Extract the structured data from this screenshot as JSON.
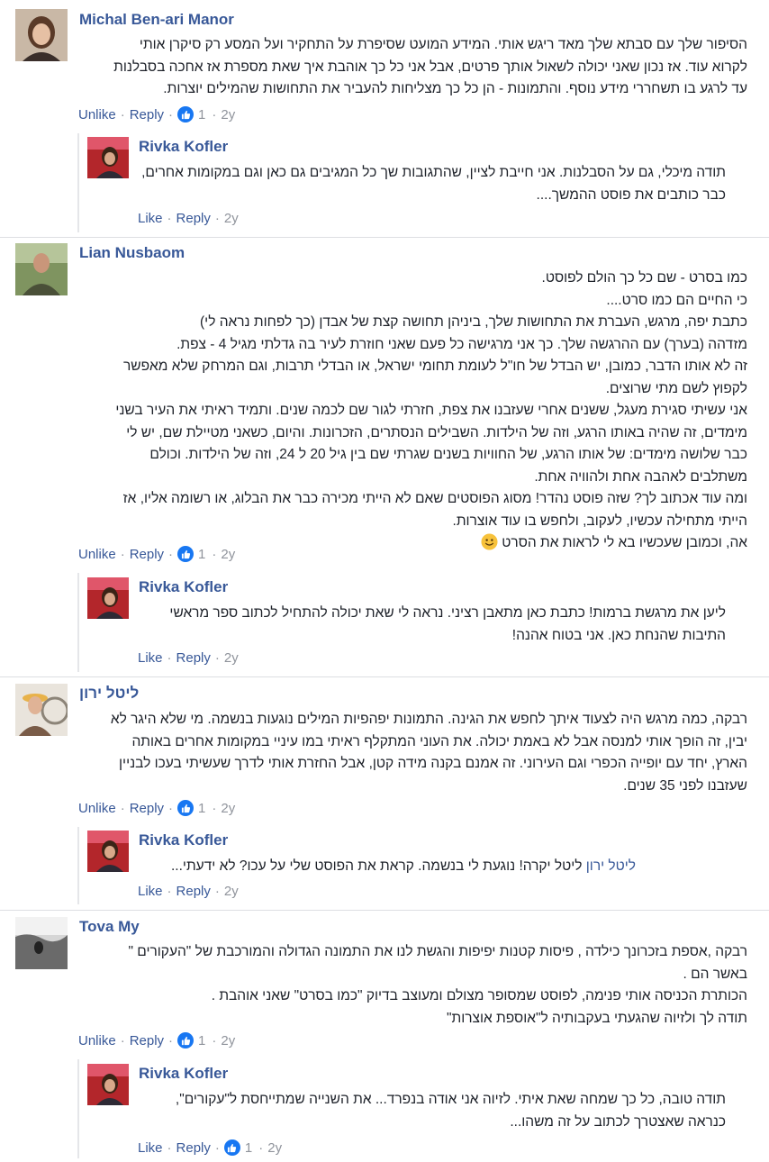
{
  "comments": [
    {
      "author": "Michal Ben-ari Manor",
      "lines": [
        "הסיפור שלך עם סבתא שלך מאד ריגש אותי. המידע המועט שסיפרת על התחקיר ועל המסע רק סיקרן אותי",
        "לקרוא עוד. אז נכון שאני יכולה לשאול אותך פרטים, אבל אני כל כך אוהבת איך שאת מספרת אז אחכה בסבלנות",
        "עד לרגע בו תשחררי מידע נוסף. והתמונות - הן כל כך מצליחות להעביר את התחושות שהמילים יוצרות."
      ],
      "actions": {
        "like": "Unlike",
        "reply": "Reply",
        "count": "1",
        "time": "2y"
      },
      "reply": {
        "author": "Rivka Kofler",
        "lines": [
          "תודה מיכלי, גם על הסבלנות. אני חייבת לציין, שהתגובות שך כל המגיבים גם כאן וגם במקומות אחרים,",
          "כבר כותבים את פוסט ההמשך...."
        ],
        "actions": {
          "like": "Like",
          "reply": "Reply",
          "time": "2y"
        }
      }
    },
    {
      "author": "Lian Nusbaom",
      "lines": [
        "כמו בסרט - שם כל כך הולם לפוסט.",
        "כי החיים הם כמו סרט....",
        "כתבת יפה, מרגש, העברת את התחושות שלך, ביניהן תחושה קצת של אבדן (כך לפחות נראה לי)",
        "מזדהה (בערך) עם ההרגשה שלך. כך אני מרגישה כל פעם שאני חוזרת לעיר בה גדלתי מגיל 4 - צפת.",
        "זה לא אותו הדבר, כמובן, יש הבדל של חו\"ל לעומת תחומי ישראל, או הבדלי תרבות, וגם המרחק שלא מאפשר",
        "לקפוץ לשם מתי שרוצים.",
        "אני עשיתי סגירת מעגל, ששנים אחרי שעזבנו את צפת, חזרתי לגור שם לכמה שנים. ותמיד ראיתי את העיר בשני",
        "מימדים, זה שהיה באותו הרגע, וזה של הילדות. השבילים הנסתרים, הזכרונות. והיום, כשאני מטיילת שם, יש לי",
        "כבר שלושה מימדים: של אותו הרגע, של החוויות בשנים שגרתי שם בין גיל 20 ל 24, וזה של הילדות. וכולם",
        "משתלבים לאהבה אחת ולהוויה אחת.",
        "ומה עוד אכתוב לך? שזה פוסט נהדר! מסוג הפוסטים שאם לא הייתי מכירה כבר את הבלוג, או רשומה אליו, אז",
        "הייתי מתחילה עכשיו, לעקוב, ולחפש בו עוד אוצרות.",
        "אה, וכמובן שעכשיו בא לי לראות את הסרט"
      ],
      "emoji_name": "smiley-emoji",
      "actions": {
        "like": "Unlike",
        "reply": "Reply",
        "count": "1",
        "time": "2y"
      },
      "reply": {
        "author": "Rivka Kofler",
        "lines": [
          "ליען את מרגשת ברמות! כתבת כאן מתאבן רציני. נראה לי שאת יכולה להתחיל לכתוב ספר מראשי",
          "התיבות שהנחת כאן. אני בטוח אהנה!"
        ],
        "actions": {
          "like": "Like",
          "reply": "Reply",
          "time": "2y"
        }
      }
    },
    {
      "author": "ליטל ירון",
      "lines": [
        "רבקה, כמה מרגש היה לצעוד איתך לחפש את הגינה. התמונות יפהפיות המילים נוגעות בנשמה. מי שלא היגר לא",
        "יבין, זה הופך אותי למנסה אבל לא באמת יכולה. את העוני המתקלף ראיתי במו עיניי במקומות אחרים באותה",
        "הארץ, יחד עם יופייה הכפרי וגם העירוני. זה אמנם בקנה מידה קטן, אבל החזרת אותי לדרך שעשיתי בעכו לבניין",
        "שעזבנו לפני 35 שנים."
      ],
      "actions": {
        "like": "Unlike",
        "reply": "Reply",
        "count": "1",
        "time": "2y"
      },
      "reply": {
        "author": "Rivka Kofler",
        "tag": "ליטל ירון",
        "lines": [
          "ליטל יקרה! נוגעת לי בנשמה. קראת את הפוסט שלי על עכו? לא ידעתי..."
        ],
        "actions": {
          "like": "Like",
          "reply": "Reply",
          "time": "2y"
        }
      }
    },
    {
      "author": "Tova My",
      "lines": [
        "רבקה ,אספת בזכרונך כילדה , פיסות קטנות יפיפות והגשת לנו את התמונה הגדולה והמורכבת של \"העקורים \"",
        "באשר הם .",
        "הכותרת הכניסה אותי פנימה, לפוסט שמסופר מצולם ומעוצב בדיוק \"כמו בסרט\" שאני אוהבת .",
        "תודה לך ולזיוה שהגעתי בעקבותיה ל\"אוספת אוצרות\""
      ],
      "actions": {
        "like": "Unlike",
        "reply": "Reply",
        "count": "1",
        "time": "2y"
      },
      "reply": {
        "author": "Rivka Kofler",
        "lines": [
          "תודה טובה, כל כך שמחה שאת איתי. לזיוה אני אודה בנפרד... את השנייה שמתייחסת ל\"עקורים\",",
          "כנראה שאצטרך לכתוב על זה משהו..."
        ],
        "actions": {
          "like": "Like",
          "reply": "Reply",
          "count": "1",
          "time": "2y"
        }
      }
    }
  ],
  "colors": {
    "link": "#385898",
    "meta": "#90949c",
    "text": "#1d2129",
    "like_badge": "#1877f2",
    "divider": "#dddfe2"
  },
  "icons": {
    "like": "thumbs-up-icon"
  }
}
